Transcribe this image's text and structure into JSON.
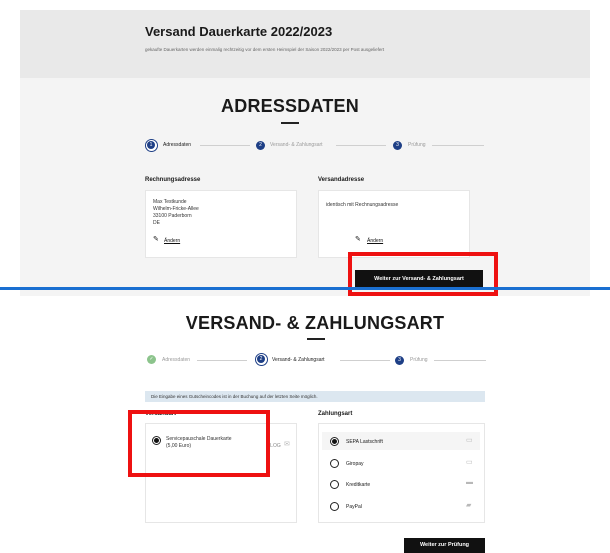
{
  "header": {
    "title": "Versand Dauerkarte 2022/2023",
    "subtitle": "gekaufte Dauerkarten werden einmalig rechtzeitig vor dem ersten Heimspiel der Saison 2022/2023 per Post ausgeliefert"
  },
  "step1": {
    "title": "ADRESSDATEN",
    "steps": [
      {
        "number": "1",
        "label": "Adressdaten"
      },
      {
        "number": "2",
        "label": "Versand- & Zahlungsart"
      },
      {
        "number": "3",
        "label": "Prüfung"
      }
    ],
    "billing": {
      "heading": "Rechnungsadresse",
      "lines": [
        "Max Testkunde",
        "Wilhelm-Fricke-Allee",
        "33100 Paderborn",
        "DE"
      ],
      "edit_label": "Ändern"
    },
    "shipping": {
      "heading": "Versandadresse",
      "lines": [
        "identisch mit Rechnungsadresse"
      ],
      "edit_label": "Ändern"
    },
    "next_button": "Weiter zur Versand- & Zahlungsart"
  },
  "step2": {
    "title": "VERSAND- & ZAHLUNGSART",
    "steps": [
      {
        "number": "",
        "label": "Adressdaten"
      },
      {
        "number": "2",
        "label": "Versand- & Zahlungsart"
      },
      {
        "number": "3",
        "label": "Prüfung"
      }
    ],
    "notice": "Die Eingabe eines Gutscheincodes ist in der Buchung auf der letzten Seite möglich.",
    "shipping": {
      "heading": "Versandart",
      "option_line1": "Servicepauschale Dauerkarte",
      "option_line2": "(5,00 Euro)",
      "carrier": "MLOG"
    },
    "payment": {
      "heading": "Zahlungsart",
      "options": [
        "SEPA Lastschrift",
        "Giropay",
        "Kreditkarte",
        "PayPal"
      ]
    },
    "next_button": "Weiter zur Prüfung"
  }
}
